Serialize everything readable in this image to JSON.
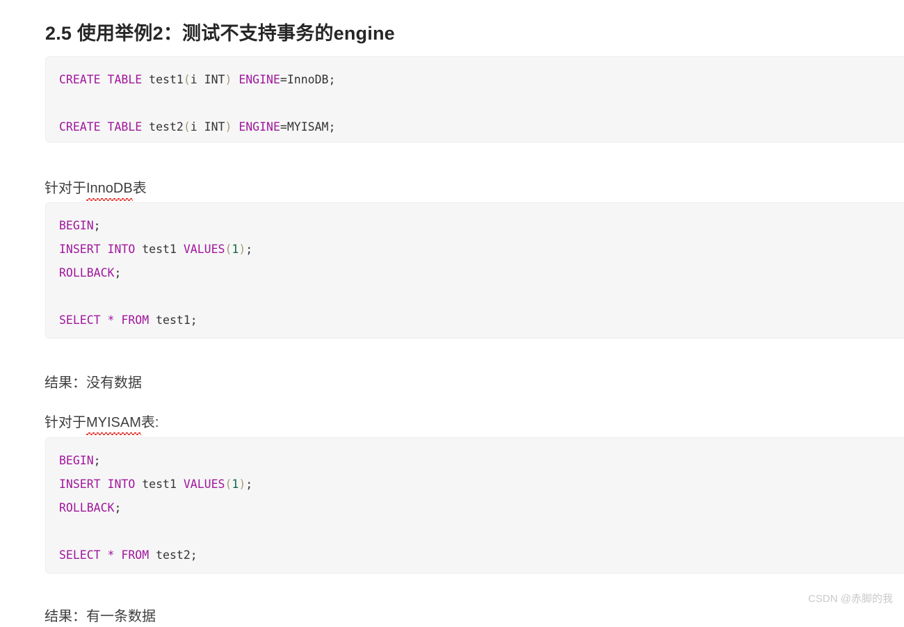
{
  "article": {
    "title": "2.5 使用举例2：测试不支持事务的engine"
  },
  "colors": {
    "page_background": "#ffffff",
    "code_background": "#f6f6f6",
    "code_border": "#ededed",
    "keyword": "#a0179d",
    "identifier": "#333333",
    "punctuation": "#a89c78",
    "number": "#116644",
    "heading": "#262626",
    "body_text": "#3f3f3f",
    "spellcheck_underline": "#e53935",
    "watermark": "#c9c9c9"
  },
  "code_blocks": [
    {
      "id": "create-tables",
      "language": "sql",
      "lines": [
        [
          {
            "t": "CREATE",
            "c": "kw"
          },
          {
            "t": " ",
            "c": "id"
          },
          {
            "t": "TABLE",
            "c": "kw"
          },
          {
            "t": " test1",
            "c": "id"
          },
          {
            "t": "(",
            "c": "pun"
          },
          {
            "t": "i INT",
            "c": "id"
          },
          {
            "t": ")",
            "c": "pun"
          },
          {
            "t": " ",
            "c": "id"
          },
          {
            "t": "ENGINE",
            "c": "kw"
          },
          {
            "t": "=InnoDB;",
            "c": "id"
          }
        ],
        [],
        [
          {
            "t": "CREATE",
            "c": "kw"
          },
          {
            "t": " ",
            "c": "id"
          },
          {
            "t": "TABLE",
            "c": "kw"
          },
          {
            "t": " test2",
            "c": "id"
          },
          {
            "t": "(",
            "c": "pun"
          },
          {
            "t": "i INT",
            "c": "id"
          },
          {
            "t": ")",
            "c": "pun"
          },
          {
            "t": " ",
            "c": "id"
          },
          {
            "t": "ENGINE",
            "c": "kw"
          },
          {
            "t": "=MYISAM;",
            "c": "id"
          }
        ]
      ],
      "plain_text": "CREATE TABLE test1(i INT) ENGINE=InnoDB;\n\nCREATE TABLE test2(i INT) ENGINE=MYISAM;"
    },
    {
      "id": "innodb-transaction-test",
      "language": "sql",
      "lines": [
        [
          {
            "t": "BEGIN",
            "c": "kw"
          },
          {
            "t": ";",
            "c": "id"
          }
        ],
        [
          {
            "t": "INSERT",
            "c": "kw"
          },
          {
            "t": " ",
            "c": "id"
          },
          {
            "t": "INTO",
            "c": "kw"
          },
          {
            "t": " test1 ",
            "c": "id"
          },
          {
            "t": "VALUES",
            "c": "kw"
          },
          {
            "t": "(",
            "c": "pun"
          },
          {
            "t": "1",
            "c": "num"
          },
          {
            "t": ")",
            "c": "pun"
          },
          {
            "t": ";",
            "c": "id"
          }
        ],
        [
          {
            "t": "ROLLBACK",
            "c": "kw"
          },
          {
            "t": ";",
            "c": "id"
          }
        ],
        [],
        [
          {
            "t": "SELECT",
            "c": "kw"
          },
          {
            "t": " ",
            "c": "id"
          },
          {
            "t": "*",
            "c": "star"
          },
          {
            "t": " ",
            "c": "id"
          },
          {
            "t": "FROM",
            "c": "kw"
          },
          {
            "t": " test1;",
            "c": "id"
          }
        ]
      ],
      "plain_text": "BEGIN;\nINSERT INTO test1 VALUES(1);\nROLLBACK;\n\nSELECT * FROM test1;"
    },
    {
      "id": "myisam-transaction-test",
      "language": "sql",
      "lines": [
        [
          {
            "t": "BEGIN",
            "c": "kw"
          },
          {
            "t": ";",
            "c": "id"
          }
        ],
        [
          {
            "t": "INSERT",
            "c": "kw"
          },
          {
            "t": " ",
            "c": "id"
          },
          {
            "t": "INTO",
            "c": "kw"
          },
          {
            "t": " test1 ",
            "c": "id"
          },
          {
            "t": "VALUES",
            "c": "kw"
          },
          {
            "t": "(",
            "c": "pun"
          },
          {
            "t": "1",
            "c": "num"
          },
          {
            "t": ")",
            "c": "pun"
          },
          {
            "t": ";",
            "c": "id"
          }
        ],
        [
          {
            "t": "ROLLBACK",
            "c": "kw"
          },
          {
            "t": ";",
            "c": "id"
          }
        ],
        [],
        [
          {
            "t": "SELECT",
            "c": "kw"
          },
          {
            "t": " ",
            "c": "id"
          },
          {
            "t": "*",
            "c": "star"
          },
          {
            "t": " ",
            "c": "id"
          },
          {
            "t": "FROM",
            "c": "kw"
          },
          {
            "t": " test2;",
            "c": "id"
          }
        ]
      ],
      "plain_text": "BEGIN;\nINSERT INTO test1 VALUES(1);\nROLLBACK;\n\nSELECT * FROM test2;"
    }
  ],
  "paragraphs": {
    "innodb_heading": {
      "prefix": "针对于",
      "misspelled": "InnoDB",
      "suffix": "表"
    },
    "innodb_result": "结果：没有数据",
    "myisam_heading": {
      "prefix": "针对于",
      "misspelled": "MYISAM",
      "suffix": "表:"
    },
    "myisam_result": "结果：有一条数据"
  },
  "watermark": {
    "text": "CSDN @赤脚的我"
  }
}
